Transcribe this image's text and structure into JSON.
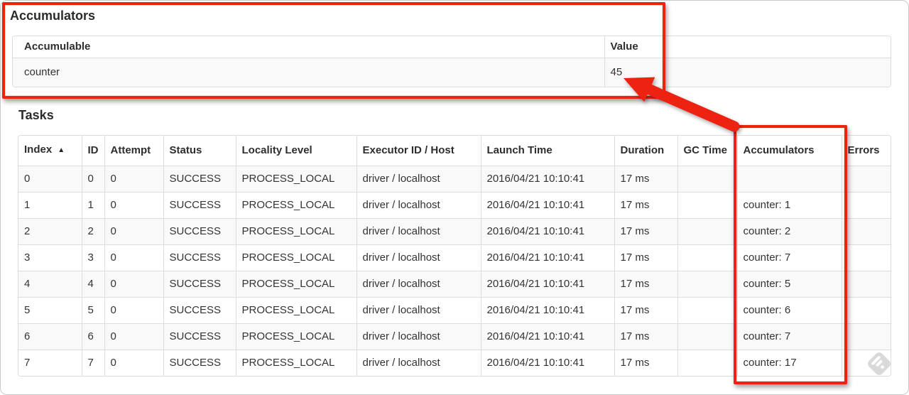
{
  "accumulators_section": {
    "heading": "Accumulators",
    "table": {
      "headers": [
        "Accumulable",
        "Value"
      ],
      "rows": [
        {
          "accumulable": "counter",
          "value": "45"
        }
      ]
    }
  },
  "tasks_section": {
    "heading": "Tasks",
    "table": {
      "headers": [
        "Index",
        "ID",
        "Attempt",
        "Status",
        "Locality Level",
        "Executor ID / Host",
        "Launch Time",
        "Duration",
        "GC Time",
        "Accumulators",
        "Errors"
      ],
      "column_keys": [
        "index",
        "id",
        "attempt",
        "status",
        "locality_level",
        "executor_id_host",
        "launch_time",
        "duration",
        "gc_time",
        "accumulators",
        "errors"
      ],
      "sorted_column": "Index",
      "rows": [
        {
          "index": "0",
          "id": "0",
          "attempt": "0",
          "status": "SUCCESS",
          "locality_level": "PROCESS_LOCAL",
          "executor_id_host": "driver / localhost",
          "launch_time": "2016/04/21 10:10:41",
          "duration": "17 ms",
          "gc_time": "",
          "accumulators": "",
          "errors": ""
        },
        {
          "index": "1",
          "id": "1",
          "attempt": "0",
          "status": "SUCCESS",
          "locality_level": "PROCESS_LOCAL",
          "executor_id_host": "driver / localhost",
          "launch_time": "2016/04/21 10:10:41",
          "duration": "17 ms",
          "gc_time": "",
          "accumulators": "counter: 1",
          "errors": ""
        },
        {
          "index": "2",
          "id": "2",
          "attempt": "0",
          "status": "SUCCESS",
          "locality_level": "PROCESS_LOCAL",
          "executor_id_host": "driver / localhost",
          "launch_time": "2016/04/21 10:10:41",
          "duration": "17 ms",
          "gc_time": "",
          "accumulators": "counter: 2",
          "errors": ""
        },
        {
          "index": "3",
          "id": "3",
          "attempt": "0",
          "status": "SUCCESS",
          "locality_level": "PROCESS_LOCAL",
          "executor_id_host": "driver / localhost",
          "launch_time": "2016/04/21 10:10:41",
          "duration": "17 ms",
          "gc_time": "",
          "accumulators": "counter: 7",
          "errors": ""
        },
        {
          "index": "4",
          "id": "4",
          "attempt": "0",
          "status": "SUCCESS",
          "locality_level": "PROCESS_LOCAL",
          "executor_id_host": "driver / localhost",
          "launch_time": "2016/04/21 10:10:41",
          "duration": "17 ms",
          "gc_time": "",
          "accumulators": "counter: 5",
          "errors": ""
        },
        {
          "index": "5",
          "id": "5",
          "attempt": "0",
          "status": "SUCCESS",
          "locality_level": "PROCESS_LOCAL",
          "executor_id_host": "driver / localhost",
          "launch_time": "2016/04/21 10:10:41",
          "duration": "17 ms",
          "gc_time": "",
          "accumulators": "counter: 6",
          "errors": ""
        },
        {
          "index": "6",
          "id": "6",
          "attempt": "0",
          "status": "SUCCESS",
          "locality_level": "PROCESS_LOCAL",
          "executor_id_host": "driver / localhost",
          "launch_time": "2016/04/21 10:10:41",
          "duration": "17 ms",
          "gc_time": "",
          "accumulators": "counter: 7",
          "errors": ""
        },
        {
          "index": "7",
          "id": "7",
          "attempt": "0",
          "status": "SUCCESS",
          "locality_level": "PROCESS_LOCAL",
          "executor_id_host": "driver / localhost",
          "launch_time": "2016/04/21 10:10:41",
          "duration": "17 ms",
          "gc_time": "",
          "accumulators": "counter: 17",
          "errors": ""
        }
      ]
    }
  },
  "icons": {
    "sort_ascending": "▲",
    "watermark": "stamp-diamond"
  },
  "annotations": {
    "highlight_color": "#ee2211"
  }
}
